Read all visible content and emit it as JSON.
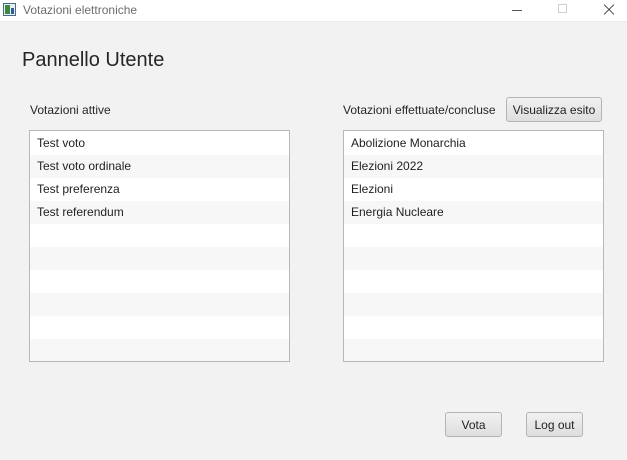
{
  "window": {
    "title": "Votazioni elettroniche"
  },
  "page": {
    "title": "Pannello Utente"
  },
  "active": {
    "label": "Votazioni attive",
    "items": [
      "Test voto",
      "Test voto ordinale",
      "Test preferenza",
      "Test referendum"
    ]
  },
  "concluded": {
    "label": "Votazioni effettuate/concluse",
    "button": "Visualizza esito",
    "items": [
      "Abolizione Monarchia",
      "Elezioni 2022",
      "Elezioni",
      "Energia Nucleare"
    ]
  },
  "actions": {
    "vote": "Vota",
    "logout": "Log out"
  }
}
